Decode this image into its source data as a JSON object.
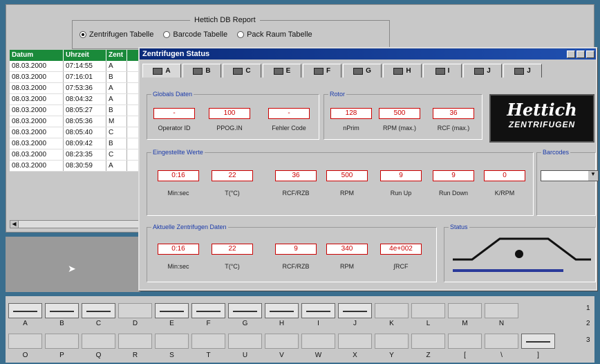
{
  "report": {
    "title": "Hettich DB Report",
    "options": [
      "Zentrifugen Tabelle",
      "Barcode Tabelle",
      "Pack Raum Tabelle"
    ],
    "selected": 0
  },
  "table": {
    "headers": [
      "Datum",
      "Uhrzeit",
      "Zent"
    ],
    "rows": [
      [
        "08.03.2000",
        "07:14:55",
        "A"
      ],
      [
        "08.03.2000",
        "07:16:01",
        "B"
      ],
      [
        "08.03.2000",
        "07:53:36",
        "A"
      ],
      [
        "08.03.2000",
        "08:04:32",
        "A"
      ],
      [
        "08.03.2000",
        "08:05:27",
        "B"
      ],
      [
        "08.03.2000",
        "08:05:36",
        "M"
      ],
      [
        "08.03.2000",
        "08:05:40",
        "C"
      ],
      [
        "08.03.2000",
        "08:09:42",
        "B"
      ],
      [
        "08.03.2000",
        "08:23:35",
        "C"
      ],
      [
        "08.03.2000",
        "08:30:59",
        "A"
      ]
    ]
  },
  "window": {
    "title": "Zentrifugen Status"
  },
  "tabs": [
    "A",
    "B",
    "C",
    "E",
    "F",
    "G",
    "H",
    "I",
    "J",
    "J"
  ],
  "globals": {
    "title": "Globals Daten",
    "values": [
      "-",
      "100",
      "-"
    ],
    "labels": [
      "Operator ID",
      "PPOG.IN",
      "Fehler Code"
    ]
  },
  "rotor": {
    "title": "Rotor",
    "values": [
      "128",
      "500",
      "36"
    ],
    "labels": [
      "nPrim",
      "RPM (max.)",
      "RCF (max.)"
    ]
  },
  "logo": {
    "line1": "Hettich",
    "line2": "ZENTRIFUGEN"
  },
  "preset": {
    "title": "Eingestellte Werte",
    "values": [
      "0:16",
      "22",
      "36",
      "500",
      "9",
      "9",
      "0"
    ],
    "labels": [
      "Min:sec",
      "T(°C)",
      "RCF/RZB",
      "RPM",
      "Run Up",
      "Run Down",
      "K/RPM"
    ]
  },
  "barcodes": {
    "title": "Barcodes"
  },
  "actual": {
    "title": "Aktuelle Zentrifugen Daten",
    "values": [
      "0:16",
      "22",
      "9",
      "340",
      "4e+002"
    ],
    "labels": [
      "Min:sec",
      "T(°C)",
      "RCF/RZB",
      "RPM",
      "∫RCF"
    ]
  },
  "status": {
    "title": "Status"
  },
  "keys_row1": [
    "A",
    "B",
    "C",
    "D",
    "E",
    "F",
    "G",
    "H",
    "I",
    "J",
    "K",
    "L",
    "M",
    "N"
  ],
  "keys_row2": [
    "O",
    "P",
    "Q",
    "R",
    "S",
    "T",
    "U",
    "V",
    "W",
    "X",
    "Y",
    "Z",
    "[",
    "\\",
    "]"
  ],
  "side_nums": [
    "1",
    "2",
    "3"
  ]
}
